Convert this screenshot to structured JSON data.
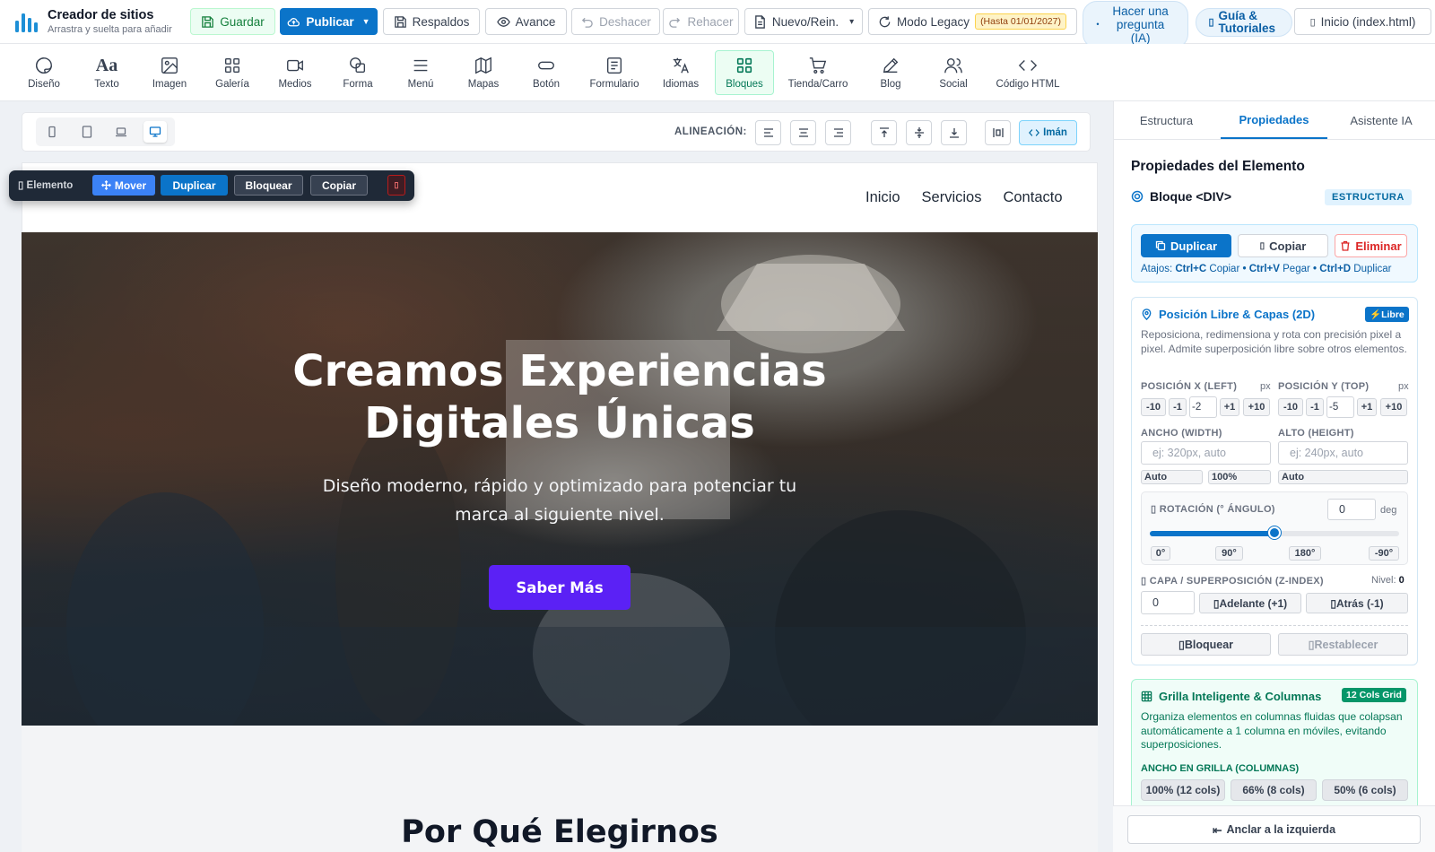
{
  "brand": {
    "title": "Creador de sitios",
    "subtitle": "Arrastra y suelta para añadir"
  },
  "topbar": {
    "save": "Guardar",
    "publish": "Publicar",
    "publish_caret": "▼",
    "backups": "Respaldos",
    "preview": "Avance",
    "undo": "Deshacer",
    "redo": "Rehacer",
    "new_page": "Nuevo/Rein.",
    "new_caret": "▾",
    "legacy": "Modo Legacy",
    "legacy_badge": "(Hasta 01/01/2027)",
    "ask_ai": "Hacer una pregunta (IA)",
    "ask_ai_bullet": "•",
    "guides": "Guía & Tutoriales",
    "guides_mark": "▯",
    "page_select": "Inicio (index.html)",
    "page_select_mark": "▯"
  },
  "toolbar": {
    "design": "Diseño",
    "text": "Texto",
    "text_icon": "Aa",
    "image": "Imagen",
    "gallery": "Galería",
    "media": "Medios",
    "shape": "Forma",
    "menu": "Menú",
    "maps": "Mapas",
    "button": "Botón",
    "form": "Formulario",
    "languages": "Idiomas",
    "blocks": "Bloques",
    "shop": "Tienda/Carro",
    "blog": "Blog",
    "social": "Social",
    "html": "Código HTML"
  },
  "canvas": {
    "align_label": "ALINEACIÓN:",
    "magnet": "Imán"
  },
  "element_toolbar": {
    "mark": "▯",
    "label": "Elemento",
    "move": "Mover",
    "duplicate": "Duplicar",
    "lock": "Bloquear",
    "copy": "Copiar",
    "delete": "▯"
  },
  "site": {
    "nav": [
      "Inicio",
      "Servicios",
      "Contacto"
    ],
    "hero_title_line1": "Creamos Experiencias",
    "hero_title_line2": "Digitales Únicas",
    "hero_subtitle": "Diseño moderno, rápido y optimizado para potenciar tu marca al siguiente nivel.",
    "hero_button": "Saber Más",
    "section_title": "Por Qué Elegirnos"
  },
  "panel": {
    "tabs": [
      "Estructura",
      "Propiedades",
      "Asistente IA"
    ],
    "heading": "Propiedades del Elemento",
    "block_name": "Bloque <DIV>",
    "block_badge": "ESTRUCTURA",
    "duplicate": "Duplicar",
    "copy": "Copiar",
    "copy_mark": "▯",
    "delete": "Eliminar",
    "shortcuts": {
      "prefix": "Atajos:",
      "k1": "Ctrl+C",
      "a1": "Copiar",
      "k2": "Ctrl+V",
      "a2": "Pegar",
      "k3": "Ctrl+D",
      "a3": "Duplicar",
      "sep": "•"
    },
    "position": {
      "title": "Posición Libre & Capas (2D)",
      "badge": "⚡Libre",
      "desc": "Reposiciona, redimensiona y rota con precisión pixel a pixel. Admite superposición libre sobre otros elementos.",
      "x_label": "POSICIÓN X (LEFT)",
      "y_label": "POSICIÓN Y (TOP)",
      "unit_px": "px",
      "x_value": "-2",
      "y_value": "-5",
      "step_m10": "-10",
      "step_m1": "-1",
      "step_p1": "+1",
      "step_p10": "+10",
      "width_label": "ANCHO (WIDTH)",
      "height_label": "ALTO (HEIGHT)",
      "width_placeholder": "ej: 320px, auto",
      "height_placeholder": "ej: 240px, auto",
      "q_auto": "Auto",
      "q_100": "100%",
      "rotation_mark": "▯",
      "rotation_label": "ROTACIÓN (° ÁNGULO)",
      "rotation_value": "0",
      "rotation_unit": "deg",
      "rotation_slider_fraction": 0.5,
      "rot_presets": [
        "0°",
        "90°",
        "180°",
        "-90°"
      ],
      "z_mark": "▯",
      "z_label": "CAPA / SUPERPOSICIÓN (Z-INDEX)",
      "z_level_label": "Nivel:",
      "z_level_value": "0",
      "z_value": "0",
      "z_forward": "Adelante (+1)",
      "z_back": "Atrás (-1)",
      "btn_mark": "▯",
      "lock": "Bloquear",
      "reset": "Restablecer"
    },
    "grid": {
      "title": "Grilla Inteligente & Columnas",
      "badge": "12 Cols Grid",
      "desc": "Organiza elementos en columnas fluidas que colapsan automáticamente a 1 columna en móviles, evitando superposiciones.",
      "label": "ANCHO EN GRILLA (COLUMNAS)",
      "options": [
        "100% (12 cols)",
        "66% (8 cols)",
        "50% (6 cols)"
      ]
    },
    "anchor": "Anclar a la izquierda",
    "anchor_icon": "⇤"
  },
  "colors": {
    "accent": "#0b74c9",
    "brand_button": "#5b21f5",
    "success": "#15803d",
    "danger": "#dc2626"
  }
}
